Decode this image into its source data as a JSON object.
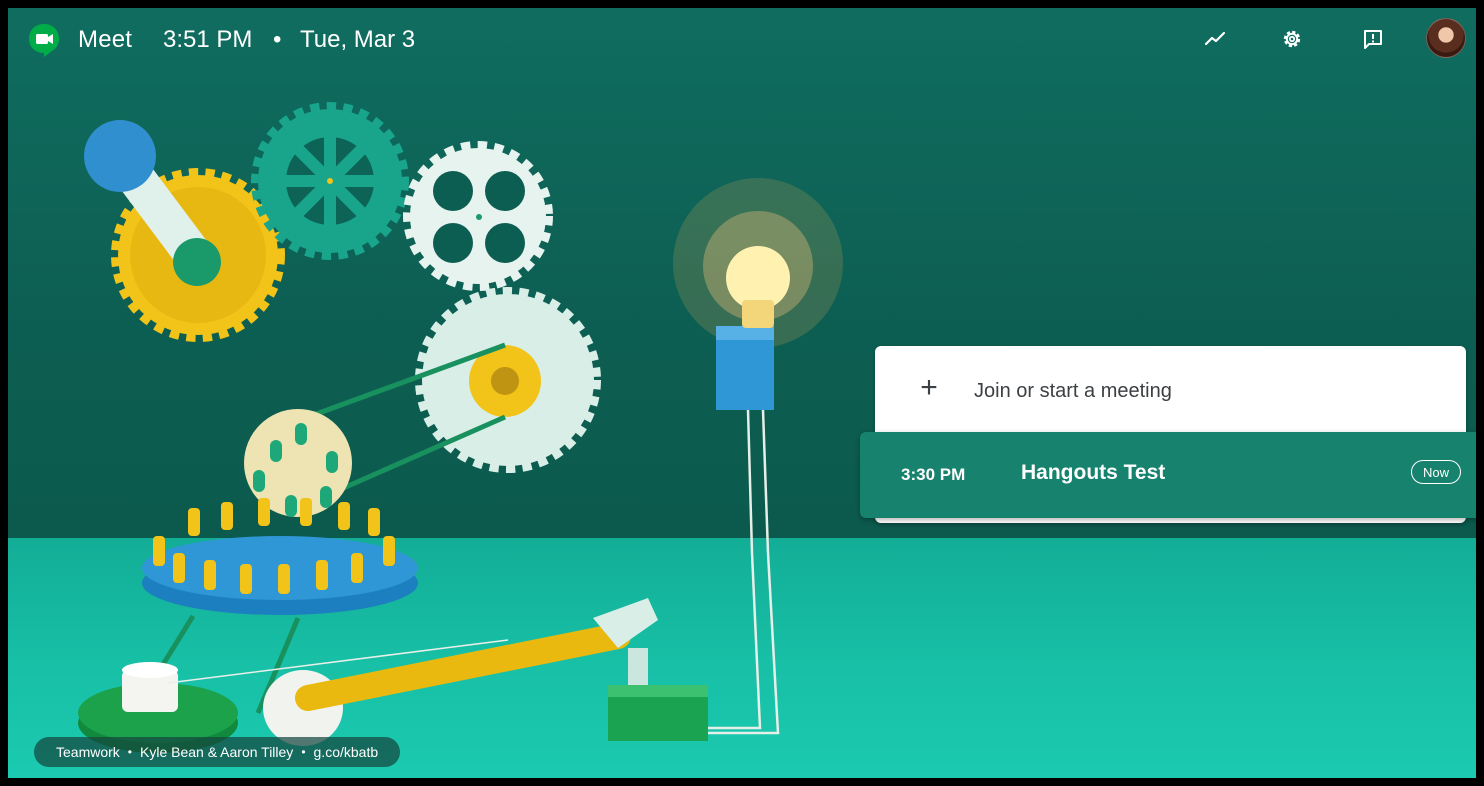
{
  "topbar": {
    "app_name": "Meet",
    "time": "3:51 PM",
    "separator": "•",
    "date": "Tue, Mar 3",
    "icons": [
      "trend-icon",
      "gear-icon",
      "feedback-icon",
      "avatar"
    ]
  },
  "join": {
    "plus": "+",
    "label": "Join or start a meeting"
  },
  "meetings": [
    {
      "time": "3:30 PM",
      "title": "Hangouts Test",
      "badge": "Now"
    }
  ],
  "credit": {
    "title": "Teamwork",
    "dot": "•",
    "artists": "Kyle Bean & Aaron Tilley",
    "link": "g.co/kbatb"
  },
  "colors": {
    "wall": "#0f6d5f",
    "floor": "#17bfa5",
    "meeting_row": "#17826d",
    "logo_green": "#00ac47"
  }
}
